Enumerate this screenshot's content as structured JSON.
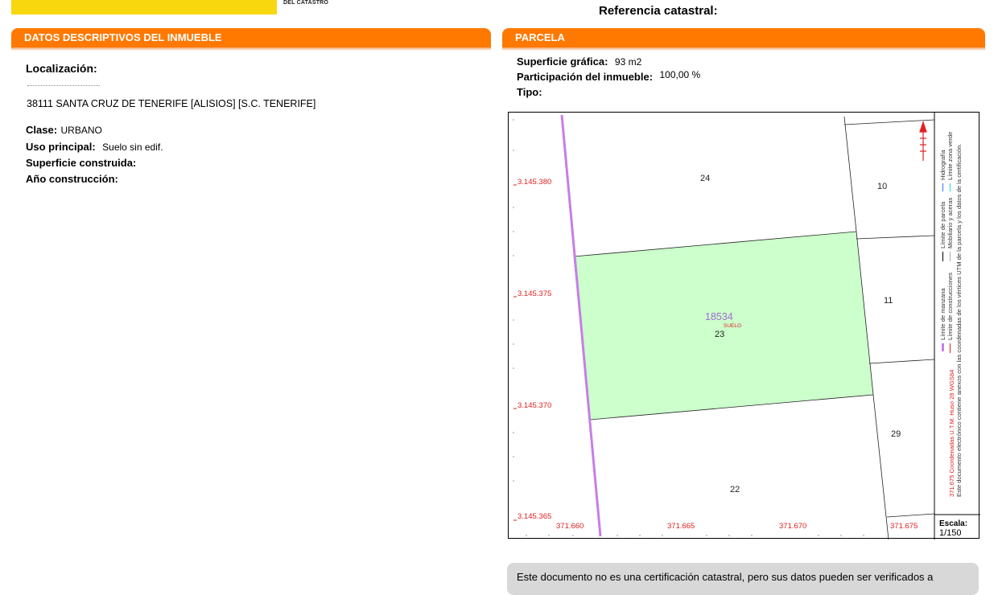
{
  "header": {
    "logo_subtitle": "DEL CATASTRO",
    "reference_label": "Referencia catastral:"
  },
  "left_panel": {
    "title": "DATOS DESCRIPTIVOS DEL INMUEBLE",
    "localizacion_label": "Localización:",
    "address_line": "38111 SANTA CRUZ DE TENERIFE [ALISIOS] [S.C. TENERIFE]",
    "clase_label": "Clase:",
    "clase_value": "URBANO",
    "uso_label": "Uso principal:",
    "uso_value": "Suelo sin edif.",
    "superficie_label": "Superficie construida:",
    "anio_label": "Año construcción:"
  },
  "right_panel": {
    "title": "PARCELA",
    "superficie_label": "Superficie gráfica:",
    "superficie_value": "93 m2",
    "participacion_label": "Participación del inmueble:",
    "participacion_value": "100,00 %",
    "tipo_label": "Tipo:"
  },
  "map": {
    "y_ticks": [
      "3.145.380",
      "3.145.375",
      "3.145.370",
      "3.145.365"
    ],
    "x_ticks": [
      "371.660",
      "371.665",
      "371.670",
      "371.675"
    ],
    "parcels": {
      "p24": "24",
      "p10": "10",
      "p11": "11",
      "p23": "23",
      "p29": "29",
      "p22": "22"
    },
    "main_parcel_ref": "18534",
    "main_parcel_type": "SUELO",
    "scale_label": "Escala:",
    "scale_value": "1/150",
    "legend": {
      "coords_text": "371.675 Coordenadas U.T.M. Huso 28 WGS84",
      "electronic_text": "Este documento electrónico contiene anexos con las coordenadas de los vértices UTM de la parcela y los datos de la certificación.",
      "item_manzana": "Límite de manzana",
      "item_parcela": "Límite de parcela",
      "item_hidrografia": "Hidrografía",
      "item_construcciones": "Límite de construcciones",
      "item_mobiliario": "Mobiliario y aceras",
      "item_zona_verde": "Límite zona verde"
    },
    "colors": {
      "parcel_fill": "#ccffcc",
      "manzana_line": "#c77ee8",
      "coord_text": "#e02020",
      "ref_text": "#a070d0"
    }
  },
  "notice": {
    "text": "Este documento no es una certificación catastral, pero sus datos pueden ser verificados a"
  }
}
